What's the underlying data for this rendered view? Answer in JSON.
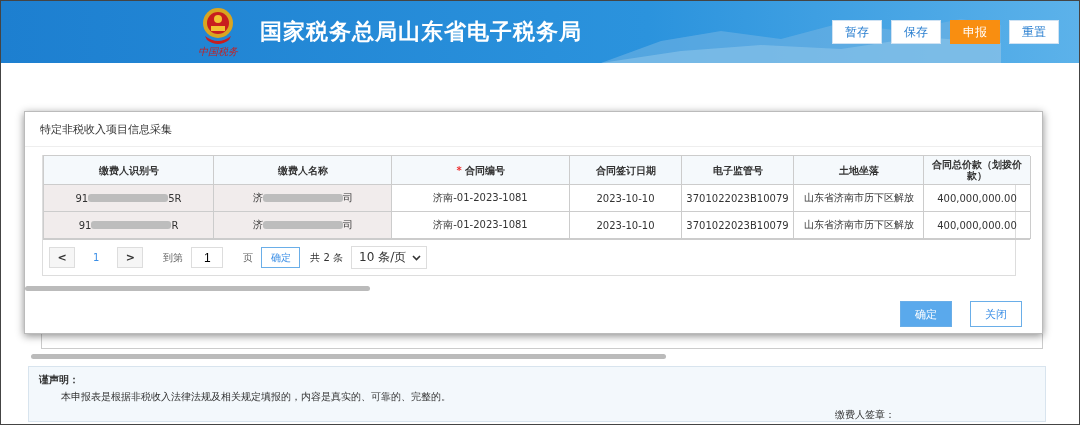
{
  "header": {
    "title": "国家税务总局山东省电子税务局",
    "emblem_caption": "中国税务",
    "buttons": [
      {
        "label": "暂存",
        "kind": "plain"
      },
      {
        "label": "保存",
        "kind": "plain"
      },
      {
        "label": "申报",
        "kind": "primary"
      },
      {
        "label": "重置",
        "kind": "plain"
      }
    ]
  },
  "dialog": {
    "title": "特定非税收入项目信息采集",
    "table": {
      "columns": [
        {
          "label": "缴费人识别号",
          "required": false
        },
        {
          "label": "缴费人名称",
          "required": false
        },
        {
          "label": "合同编号",
          "required": true,
          "required_mark": "*"
        },
        {
          "label": "合同签订日期",
          "required": false
        },
        {
          "label": "电子监管号",
          "required": false
        },
        {
          "label": "土地坐落",
          "required": false
        },
        {
          "label": "合同总价款（划拨价款）",
          "required": false
        }
      ],
      "rows": [
        {
          "payer_id": {
            "start": "91",
            "end": "5R"
          },
          "payer_name": {
            "start": "济",
            "end": "司"
          },
          "contract_no": "济南-01-2023-1081",
          "sign_date": "2023-10-10",
          "supervision_no": "3701022023B10079",
          "land_location": "山东省济南市历下区解放",
          "total_price": "400,000,000.00"
        },
        {
          "payer_id": {
            "start": "91",
            "end": "R"
          },
          "payer_name": {
            "start": "济",
            "end": "司"
          },
          "contract_no": "济南-01-2023-1081",
          "sign_date": "2023-10-10",
          "supervision_no": "3701022023B10079",
          "land_location": "山东省济南市历下区解放",
          "total_price": "400,000,000.00"
        }
      ]
    },
    "pagination": {
      "prev": "<",
      "page": "1",
      "next": ">",
      "goto_label": "到第",
      "goto_value": "1",
      "page_unit": "页",
      "confirm": "确定",
      "total": "共 2 条",
      "page_size": "10 条/页"
    },
    "buttons": [
      {
        "label": "确定",
        "kind": "primary"
      },
      {
        "label": "关闭",
        "kind": "plain"
      }
    ]
  },
  "declaration": {
    "title": "谨声明：",
    "text": "本申报表是根据非税收入法律法规及相关规定填报的，内容是真实的、可靠的、完整的。",
    "signature_label": "缴费人签章："
  }
}
